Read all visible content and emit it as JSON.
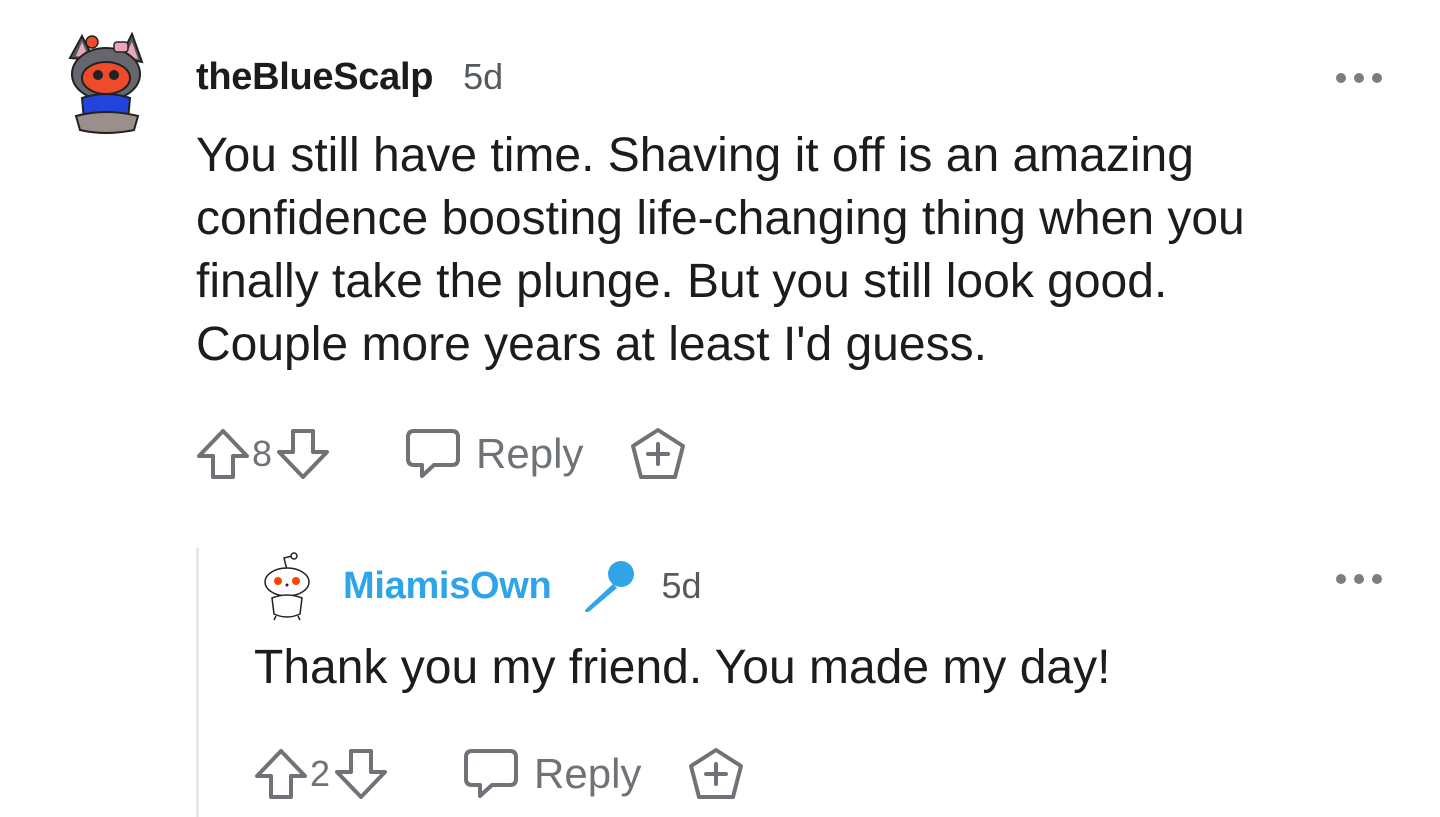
{
  "comments": [
    {
      "username": "theBlueScalp",
      "age": "5d",
      "body": "You still have time. Shaving it off is an amazing\nconfidence boosting life-changing thing when you\nfinally take the plunge. But you still look good.\nCouple more years at least I'd guess.",
      "score": "8",
      "reply_label": "Reply",
      "avatar_icon": "snoo-avatar-icon"
    },
    {
      "username": "MiamisOwn",
      "op_badge_icon": "microphone-icon",
      "age": "5d",
      "body": "Thank you my friend. You made my day!",
      "score": "2",
      "reply_label": "Reply",
      "avatar_icon": "default-snoo-avatar-icon"
    }
  ],
  "colors": {
    "op_username": "#2fa5e8",
    "text": "#1c1c1c",
    "muted": "#6f7377",
    "thread_line": "#e5e7e9"
  }
}
